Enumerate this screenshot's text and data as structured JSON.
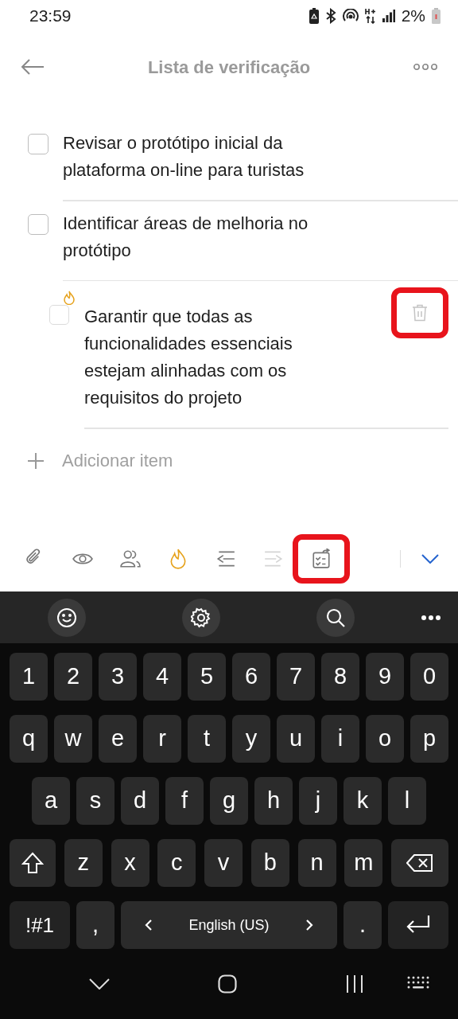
{
  "status_bar": {
    "time": "23:59",
    "battery": "2%"
  },
  "header": {
    "title": "Lista de verificação"
  },
  "checklist": [
    {
      "text_lines": [
        "Revisar o protótipo inicial da",
        "plataforma on-line para turistas"
      ],
      "checked": false
    },
    {
      "text_lines": [
        "Identificar áreas de melhoria no",
        "protótipo"
      ],
      "checked": false,
      "children": [
        {
          "text_lines": [
            "Garantir que todas as",
            "funcionalidades essenciais",
            "estejam alinhadas com os",
            "requisitos do projeto"
          ],
          "checked": false,
          "important": true,
          "highlighted": true
        }
      ]
    }
  ],
  "add_item": {
    "placeholder": "Adicionar item"
  },
  "toolbar": [
    {
      "kind": "attach",
      "on": false,
      "disabled": false
    },
    {
      "kind": "view",
      "on": false,
      "disabled": false
    },
    {
      "kind": "assign",
      "on": false,
      "disabled": false
    },
    {
      "kind": "important",
      "on": true,
      "disabled": false
    },
    {
      "kind": "outdent",
      "on": false,
      "disabled": false
    },
    {
      "kind": "indent",
      "on": false,
      "disabled": true
    },
    {
      "kind": "convert",
      "on": false,
      "disabled": false,
      "highlighted": true
    }
  ],
  "keyboard": {
    "key_rows": [
      [
        "1",
        "2",
        "3",
        "4",
        "5",
        "6",
        "7",
        "8",
        "9",
        "0"
      ],
      [
        "q",
        "w",
        "e",
        "r",
        "t",
        "y",
        "u",
        "i",
        "o",
        "p"
      ],
      [
        "a",
        "s",
        "d",
        "f",
        "g",
        "h",
        "j",
        "k",
        "l"
      ],
      [
        "z",
        "x",
        "c",
        "v",
        "b",
        "n",
        "m"
      ]
    ],
    "bottom_row": {
      "symbols": "!#1",
      "comma": ",",
      "language": "English (US)",
      "period": "."
    }
  }
}
